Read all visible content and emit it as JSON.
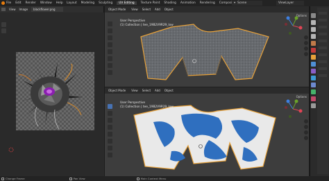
{
  "topbar": {
    "menu": [
      "File",
      "Edit",
      "Render",
      "Window",
      "Help"
    ],
    "tabs": [
      "Layout",
      "Modeling",
      "Sculpting",
      "UV Editing",
      "Texture Paint",
      "Shading",
      "Animation",
      "Rendering",
      "Compositing"
    ],
    "active_tab": "UV Editing",
    "scene": "Scene",
    "view_layer": "ViewLayer"
  },
  "image_editor": {
    "menu": [
      "View",
      "Image"
    ],
    "file": "blackflower.png"
  },
  "viewport_top": {
    "menu": [
      "Object Mode",
      "View",
      "Select",
      "Add",
      "Object"
    ],
    "info_line1": "User Perspective",
    "info_line2": "(1) Collection | tee_19B2V9R29_low",
    "options": "Options"
  },
  "viewport_bottom": {
    "menu": [
      "Object Mode",
      "View",
      "Select",
      "Add",
      "Object"
    ],
    "info_line1": "User Perspective",
    "info_line2": "(1) Collection | tee_19B2V9R29_low",
    "options": "Options"
  },
  "status": {
    "left": "Change Frame",
    "middle": "Pan View",
    "right": "Main Context Menu"
  },
  "colors": {
    "accent": "#4772b3",
    "selection_outline": "#e8a23a",
    "print_blue": "#2f6fbf",
    "fabric": "#6b6e72"
  }
}
